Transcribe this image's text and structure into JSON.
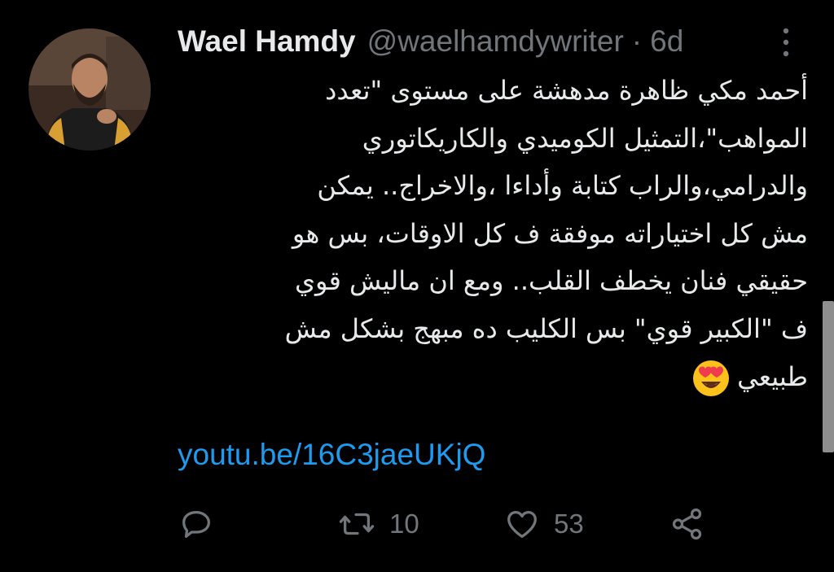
{
  "tweet": {
    "author": {
      "name": "Wael Hamdy",
      "handle": "@waelhamdywriter",
      "separator": "·",
      "time": "6d",
      "avatar_icon": "profile-photo"
    },
    "body_lines": [
      "أحمد مكي ظاهرة مدهشة على مستوى \"تعدد",
      "المواهب\"،التمثيل الكوميدي والكاريكاتوري",
      "والدرامي،والراب كتابة وأداءا ،والاخراج.. يمكن",
      "مش كل اختياراته موفقة ف كل الاوقات، بس هو",
      "حقيقي فنان يخطف القلب.. ومع ان ماليش قوي",
      "ف \"الكبير قوي\" بس الكليب ده مبهج بشكل مش",
      "طبيعي"
    ],
    "emoji": "smiling-face-with-heart-eyes",
    "link": "youtu.be/16C3jaeUKjQ",
    "actions": {
      "reply_icon": "reply-icon",
      "retweet_icon": "retweet-icon",
      "retweet_count": "10",
      "like_icon": "heart-icon",
      "like_count": "53",
      "share_icon": "share-icon"
    }
  },
  "colors": {
    "background": "#000000",
    "text": "#e7e9ea",
    "secondary": "#71767b",
    "link": "#1d9bf0"
  }
}
